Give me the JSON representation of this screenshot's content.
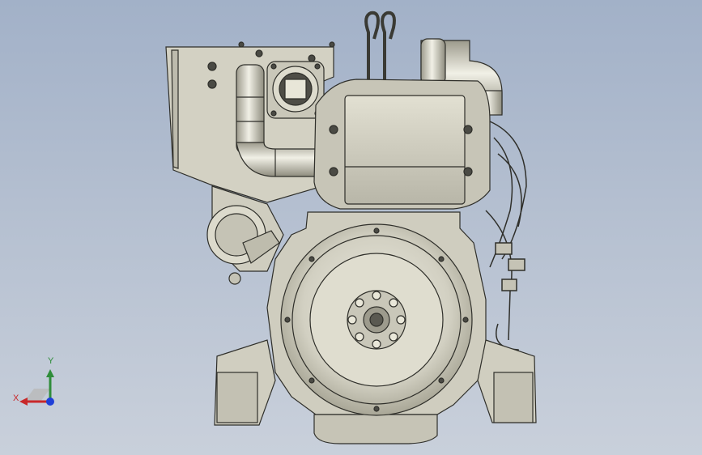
{
  "viewport": {
    "model_name": "",
    "background_top": "#a2b1c8",
    "background_bottom": "#c9d0db",
    "model_fill": "#d8d6c8",
    "model_shadow": "#a8a698",
    "model_edge": "#2f2f2a"
  },
  "triad": {
    "x_label": "X",
    "y_label": "Y",
    "x_color": "#c8282a",
    "y_color": "#2f8d3a",
    "z_color": "#1f3fd8",
    "icon": "coordinate-triad-icon"
  }
}
